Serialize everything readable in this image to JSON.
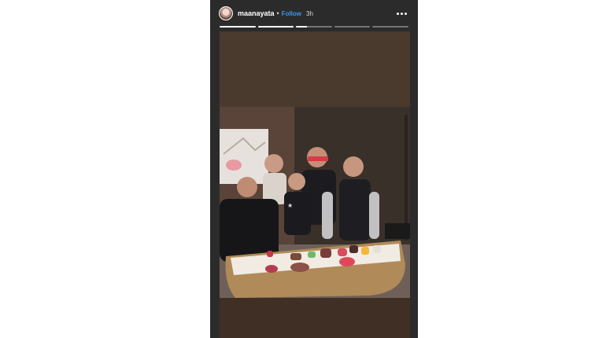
{
  "story": {
    "username": "maanayata",
    "separator": "•",
    "follow_label": "Follow",
    "time_ago": "3h",
    "segments_progress": [
      1,
      1,
      0.3,
      0,
      0
    ],
    "icons": {
      "avatar": "profile-avatar",
      "more": "more-options-icon"
    }
  }
}
